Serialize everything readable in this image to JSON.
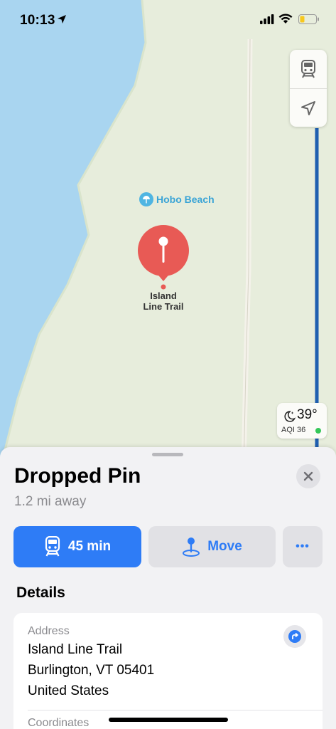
{
  "status_bar": {
    "time": "10:13",
    "icons": [
      "location-arrow-icon",
      "cellular-signal-icon",
      "wifi-icon",
      "battery-low-icon"
    ]
  },
  "map": {
    "controls": [
      "transit-icon",
      "location-arrow-icon"
    ],
    "poi_label": "Hobo Beach",
    "pin_label_line1": "Island",
    "pin_label_line2": "Line Trail",
    "weather": {
      "temperature": "39°",
      "aqi": "AQI 36",
      "aqi_color": "#34c759"
    },
    "colors": {
      "water": "#a9d5f0",
      "land": "#e7eddc",
      "pin": "#e85a55",
      "transit_line": "#1f5fb0"
    }
  },
  "sheet": {
    "title": "Dropped Pin",
    "subtitle": "1.2 mi away",
    "directions_label": "45 min",
    "move_label": "Move",
    "more_label": "•••",
    "details_heading": "Details",
    "address_label": "Address",
    "address_line1": "Island Line Trail",
    "address_line2": "Burlington, VT  05401",
    "address_line3": "United States",
    "coordinates_label": "Coordinates",
    "accent": "#2e7cf6"
  }
}
